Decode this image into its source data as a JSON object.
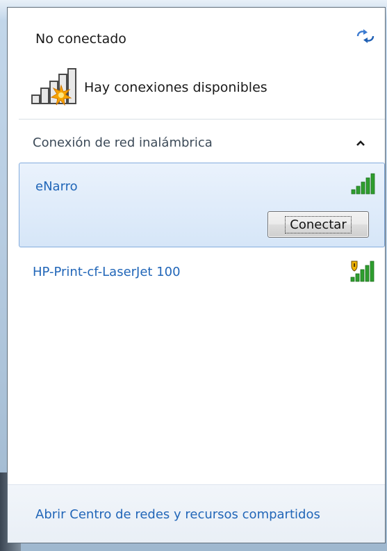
{
  "header": {
    "status": "No conectado",
    "available_text": "Hay conexiones disponibles",
    "refresh_icon": "refresh-arrows-icon",
    "available_icon": "signal-bars-star-icon"
  },
  "section": {
    "label": "Conexión de red inalámbrica",
    "collapse_icon": "chevron-up-icon",
    "expanded": true
  },
  "networks": [
    {
      "name": "eNarro",
      "signal_bars": 5,
      "secured": false,
      "selected": true,
      "connect_label": "Conectar"
    },
    {
      "name": "HP-Print-cf-LaserJet 100",
      "signal_bars": 5,
      "secured": true,
      "selected": false
    }
  ],
  "footer": {
    "link": "Abrir Centro de redes y recursos compartidos"
  },
  "colors": {
    "link": "#2166b8",
    "signal_green": "#2e9e2e",
    "selection_border": "#84acdd",
    "selection_fill": "#dce9f9"
  }
}
